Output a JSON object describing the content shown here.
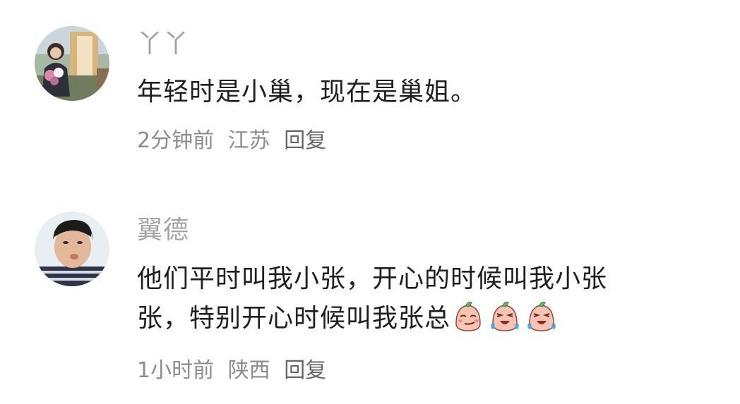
{
  "comments": [
    {
      "username": "丫丫",
      "text_lines": [
        "年轻时是小巢，现在是巢姐。"
      ],
      "time": "2分钟前",
      "location": "江苏",
      "reply_label": "回复",
      "avatar_icon": "avatar-photo-girl-with-flowers"
    },
    {
      "username": "翼德",
      "text_lines": [
        "他们平时叫我小张，开心的时候叫我小张",
        "张，特别开心时候叫我张总"
      ],
      "emojis": [
        "smirk-face-emoji",
        "laugh-cry-emoji",
        "laugh-cry-emoji"
      ],
      "time": "1小时前",
      "location": "陕西",
      "reply_label": "回复",
      "avatar_icon": "avatar-photo-boy-pouting"
    }
  ],
  "colors": {
    "username": "#a3a3a3",
    "text": "#1f1f1f",
    "meta": "#8c8c8c",
    "background": "#ffffff"
  }
}
